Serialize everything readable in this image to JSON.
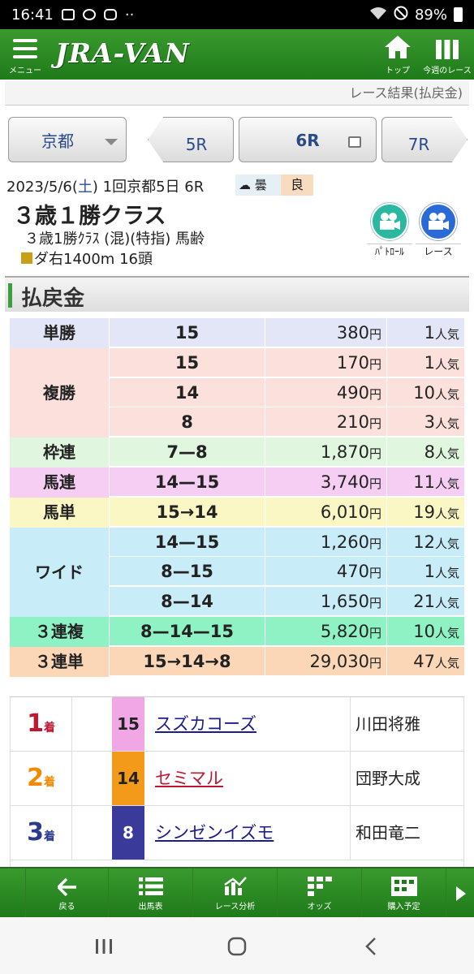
{
  "status_bar": {
    "time": "16:41",
    "battery": "89%"
  },
  "header": {
    "menu_label": "メニュー",
    "logo": "JRA-VAN",
    "top_label": "トップ",
    "week_label": "今週のレース"
  },
  "page_title": "レース結果(払戻金)",
  "race_nav": {
    "venue": "京都",
    "prev": "5R",
    "current": "6R",
    "next": "7R"
  },
  "race_info": {
    "date_prefix": "2023/5/6(",
    "weekday": "土",
    "date_suffix": ") 1回京都5日 6R",
    "weather": "曇",
    "track_condition": "良",
    "class_name": "３歳１勝クラス",
    "conditions": "３歳1勝ｸﾗｽ (混)(特指) 馬齢",
    "course": "ダ右1400m 16頭",
    "patrol_label": "ﾊﾟﾄﾛｰﾙ",
    "race_video_label": "レース"
  },
  "section_title": "払戻金",
  "yen_unit": "円",
  "pop_unit": "人気",
  "payouts": [
    {
      "type": "単勝",
      "color": "#e3e6f6",
      "rows": [
        {
          "combo": "15",
          "amount": "380",
          "pop": "1"
        }
      ]
    },
    {
      "type": "複勝",
      "color": "#fbe0dc",
      "rows": [
        {
          "combo": "15",
          "amount": "170",
          "pop": "1"
        },
        {
          "combo": "14",
          "amount": "490",
          "pop": "10"
        },
        {
          "combo": "8",
          "amount": "210",
          "pop": "3"
        }
      ]
    },
    {
      "type": "枠連",
      "color": "#e1f6df",
      "rows": [
        {
          "combo": "7—8",
          "amount": "1,870",
          "pop": "8"
        }
      ]
    },
    {
      "type": "馬連",
      "color": "#f6cdf3",
      "rows": [
        {
          "combo": "14—15",
          "amount": "3,740",
          "pop": "11"
        }
      ]
    },
    {
      "type": "馬単",
      "color": "#fbf7c4",
      "rows": [
        {
          "combo": "15→14",
          "amount": "6,010",
          "pop": "19"
        }
      ]
    },
    {
      "type": "ワイド",
      "color": "#c8ecf8",
      "rows": [
        {
          "combo": "14—15",
          "amount": "1,260",
          "pop": "12"
        },
        {
          "combo": "8—15",
          "amount": "470",
          "pop": "1"
        },
        {
          "combo": "8—14",
          "amount": "1,650",
          "pop": "21"
        }
      ]
    },
    {
      "type": "３連複",
      "color": "#8ef2c4",
      "rows": [
        {
          "combo": "8—14—15",
          "amount": "5,820",
          "pop": "10"
        }
      ]
    },
    {
      "type": "３連単",
      "color": "#fbd7b8",
      "rows": [
        {
          "combo": "15→14→8",
          "amount": "29,030",
          "pop": "47"
        }
      ]
    }
  ],
  "results": [
    {
      "rank": "1",
      "rank_suffix": "着",
      "rank_color": "#c0162f",
      "number": "15",
      "number_bg": "#f1a6e6",
      "number_fg": "#222222",
      "horse": "スズカコーズ",
      "horse_color": "#1c1c8c",
      "jockey": "川田将雅"
    },
    {
      "rank": "2",
      "rank_suffix": "着",
      "rank_color": "#f08a00",
      "number": "14",
      "number_bg": "#f39a1a",
      "number_fg": "#222222",
      "horse": "セミマル",
      "horse_color": "#c0162f",
      "jockey": "団野大成"
    },
    {
      "rank": "3",
      "rank_suffix": "着",
      "rank_color": "#2a3a8c",
      "number": "8",
      "number_bg": "#3a3a9a",
      "number_fg": "#ffffff",
      "horse": "シンゼンイズモ",
      "horse_color": "#1c1c8c",
      "jockey": "和田竜二"
    }
  ],
  "bottom_nav": [
    {
      "label": "戻る",
      "icon": "back-arrow-icon"
    },
    {
      "label": "出馬表",
      "icon": "list-icon"
    },
    {
      "label": "レース分析",
      "icon": "analysis-chart-icon"
    },
    {
      "label": "オッズ",
      "icon": "odds-grid-icon"
    },
    {
      "label": "購入予定",
      "icon": "purchase-plan-icon"
    }
  ]
}
